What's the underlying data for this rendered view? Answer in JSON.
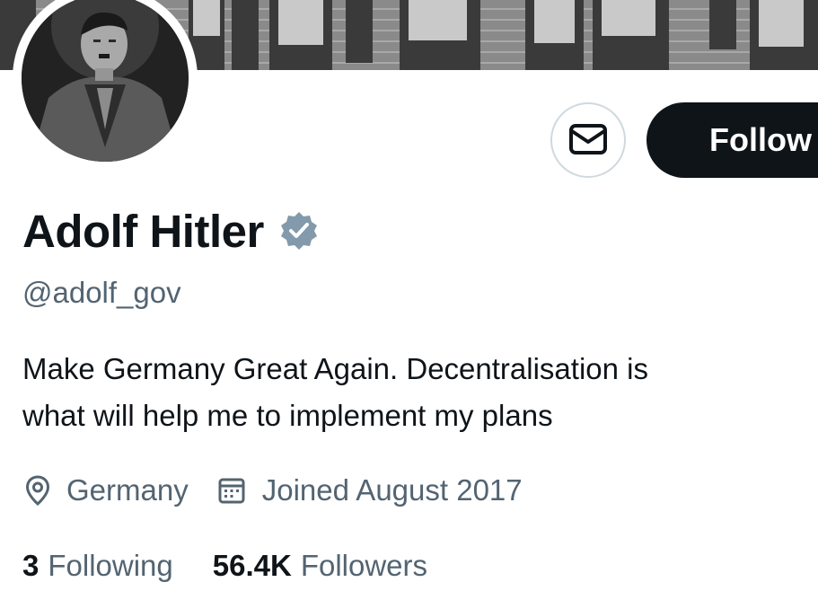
{
  "profile": {
    "display_name": "Adolf Hitler",
    "handle": "@adolf_gov",
    "bio_lines": [
      "Make Germany Great Again. Decentralisation is",
      "what will help me to implement my plans"
    ],
    "location": "Germany",
    "joined": "Joined August 2017",
    "verified": true
  },
  "actions": {
    "follow_label": "Follow",
    "message_icon": "envelope-icon"
  },
  "stats": {
    "following_count": "3",
    "following_label": "Following",
    "followers_count": "56.4K",
    "followers_label": "Followers"
  },
  "icons": {
    "verified": "verified-badge-icon",
    "location": "location-pin-icon",
    "calendar": "calendar-icon"
  },
  "colors": {
    "text_primary": "#0f1419",
    "text_secondary": "#536471",
    "verified_badge": "#829aab",
    "button_dark": "#0f1419",
    "border": "#cfd9de"
  }
}
